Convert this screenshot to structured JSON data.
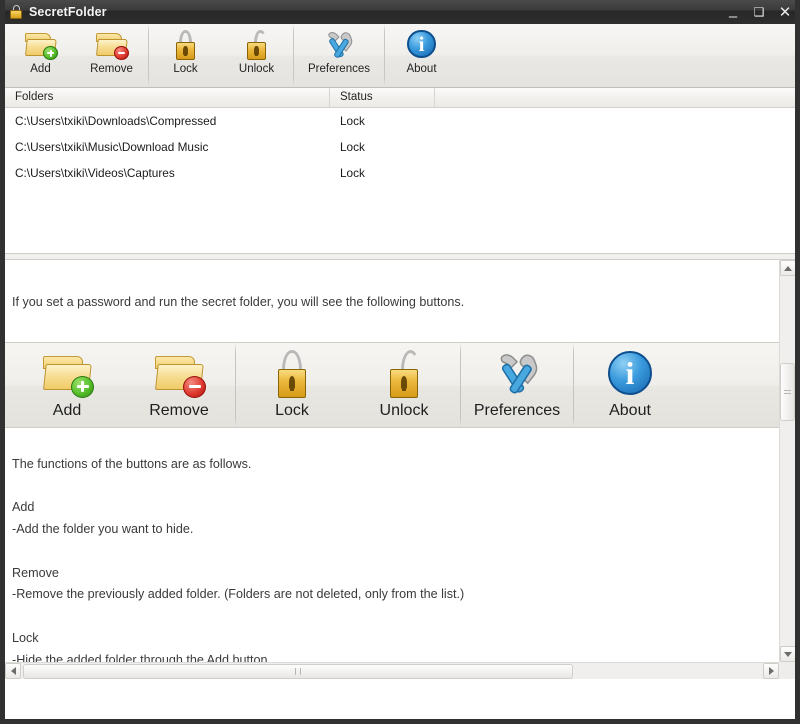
{
  "window": {
    "title": "SecretFolder",
    "app_icon": "padlock-icon",
    "controls": {
      "minimize": "–",
      "maximize": "❑",
      "close": "✕"
    }
  },
  "toolbar": {
    "items": [
      {
        "id": "add",
        "label": "Add",
        "icon": "folder-add-icon"
      },
      {
        "id": "remove",
        "label": "Remove",
        "icon": "folder-remove-icon"
      },
      {
        "id": "lock",
        "label": "Lock",
        "icon": "padlock-closed-icon"
      },
      {
        "id": "unlock",
        "label": "Unlock",
        "icon": "padlock-open-icon"
      },
      {
        "id": "preferences",
        "label": "Preferences",
        "icon": "hammer-wrench-icon"
      },
      {
        "id": "about",
        "label": "About",
        "icon": "info-circle-icon"
      }
    ]
  },
  "folder_list": {
    "columns": [
      "Folders",
      "Status",
      ""
    ],
    "rows": [
      {
        "folder": "C:\\Users\\txiki\\Downloads\\Compressed",
        "status": "Lock"
      },
      {
        "folder": "C:\\Users\\txiki\\Music\\Download Music",
        "status": "Lock"
      },
      {
        "folder": "C:\\Users\\txiki\\Videos\\Captures",
        "status": "Lock"
      }
    ]
  },
  "document": {
    "intro": "If you set a password and run the secret folder, you will see the following buttons.",
    "showcase_buttons": [
      {
        "id": "add",
        "label": "Add",
        "icon": "folder-add-icon"
      },
      {
        "id": "remove",
        "label": "Remove",
        "icon": "folder-remove-icon"
      },
      {
        "id": "lock",
        "label": "Lock",
        "icon": "padlock-closed-icon"
      },
      {
        "id": "unlock",
        "label": "Unlock",
        "icon": "padlock-open-icon"
      },
      {
        "id": "preferences",
        "label": "Preferences",
        "icon": "hammer-wrench-icon"
      },
      {
        "id": "about",
        "label": "About",
        "icon": "info-circle-icon"
      }
    ],
    "body_lines": [
      "The functions of the buttons are as follows.",
      "",
      "Add",
      "-Add the folder you want to hide.",
      "",
      "Remove",
      "-Remove the previously added folder. (Folders are not deleted, only from the list.)",
      "",
      "Lock",
      "-Hide the added folder through the Add button."
    ]
  },
  "scrollbars": {
    "vertical": {
      "up_arrow": "▲",
      "down_arrow": "▼"
    },
    "horizontal": {
      "left_arrow": "◀",
      "right_arrow": "▶"
    }
  },
  "colors": {
    "titlebar": "#2e2e2e",
    "frame": "#313131",
    "toolbar": "#eeedea",
    "folder_yellow": "#f0cb68",
    "add_badge_green": "#57bf2c",
    "remove_badge_red": "#df3a30",
    "about_blue": "#3b9bdd",
    "text": "#3a3a3a"
  }
}
